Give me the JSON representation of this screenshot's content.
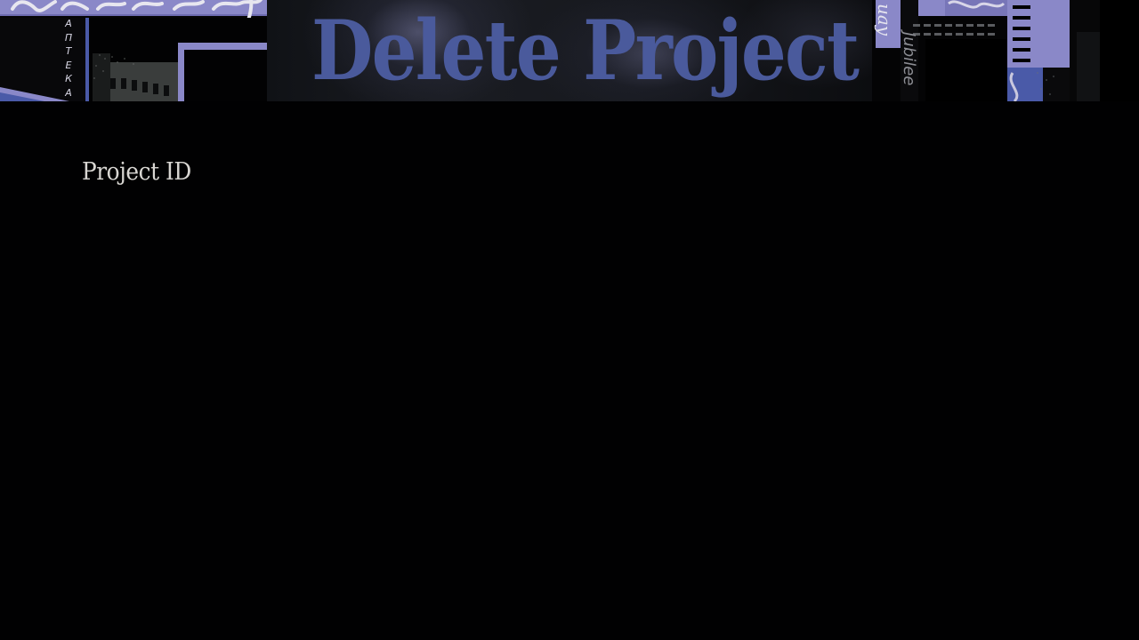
{
  "header": {
    "title": "Delete Project",
    "art_left": {
      "script_text": "Subway",
      "vertical_letters": [
        "А",
        "П",
        "Т",
        "Е",
        "К",
        "А"
      ]
    },
    "art_right": {
      "script_text": "Jubilee",
      "script_text_top": "uay"
    }
  },
  "form": {
    "project_id_label": "Project ID"
  },
  "colors": {
    "background": "#010102",
    "title": "#4a5a9c",
    "label": "#d8d6d2",
    "accent_lavender": "#8a88c8",
    "accent_blue": "#4a5aa8"
  }
}
